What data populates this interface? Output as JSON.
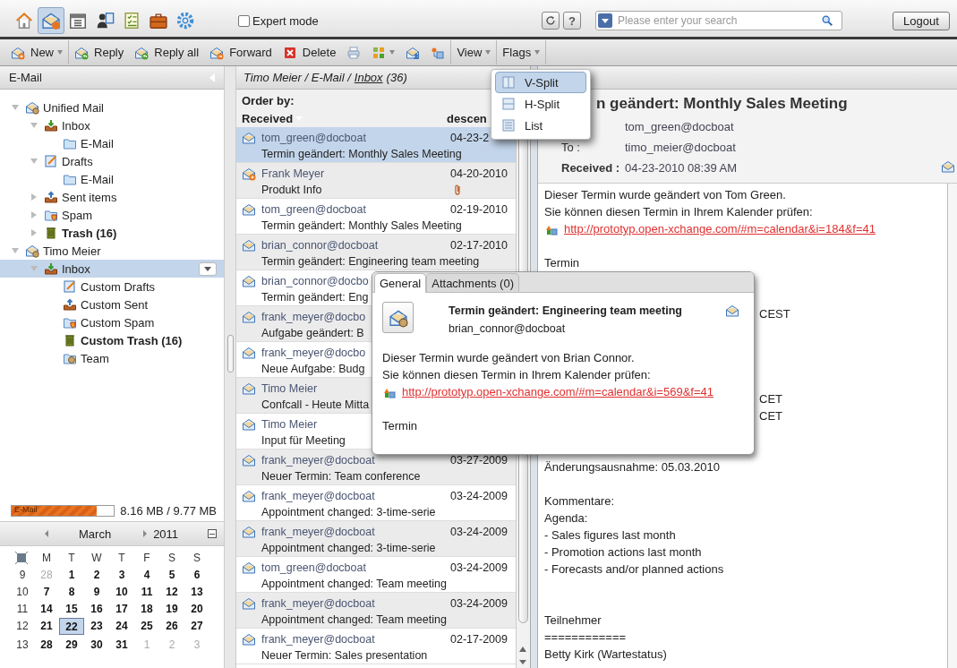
{
  "top_bar": {
    "apps": [
      {
        "kind": "home",
        "selected": false
      },
      {
        "kind": "mail",
        "selected": true
      },
      {
        "kind": "calendar",
        "selected": false
      },
      {
        "kind": "contacts",
        "selected": false
      },
      {
        "kind": "tasks",
        "selected": false
      },
      {
        "kind": "briefcase",
        "selected": false
      },
      {
        "kind": "settings",
        "selected": false
      }
    ],
    "expert_mode": {
      "label": "Expert mode",
      "checked": false
    },
    "help": "?",
    "search": {
      "placeholder": "Please enter your search"
    },
    "logout": "Logout"
  },
  "toolbar": [
    {
      "kind": "new",
      "label": "New",
      "caret": true
    },
    {
      "kind": "reply",
      "label": "Reply",
      "caret": false
    },
    {
      "kind": "reply_all",
      "label": "Reply all",
      "caret": false
    },
    {
      "kind": "forward",
      "label": "Forward",
      "caret": false
    },
    {
      "kind": "delete",
      "label": "Delete",
      "caret": false
    },
    {
      "kind": "print",
      "caret": false
    },
    {
      "kind": "layout",
      "caret": true
    },
    {
      "kind": "contacts_mail",
      "caret": false
    },
    {
      "kind": "share",
      "caret": false
    },
    {
      "kind": "menu",
      "label": "View",
      "caret": true
    },
    {
      "kind": "menu",
      "label": "Flags",
      "caret": true
    }
  ],
  "view_menu": [
    {
      "kind": "vsplit",
      "label": "V-Split",
      "selected": true
    },
    {
      "kind": "hsplit",
      "label": "H-Split",
      "selected": false
    },
    {
      "kind": "list",
      "label": "List",
      "selected": false
    }
  ],
  "sidebar": {
    "title": "E-Mail",
    "tree": [
      {
        "label": "Unified Mail",
        "kind": "account",
        "bold": false,
        "selected": false,
        "expanded": true,
        "children": [
          {
            "label": "Inbox",
            "kind": "inbox",
            "bold": false,
            "selected": false,
            "expanded": true,
            "children": [
              {
                "label": "E-Mail",
                "kind": "folder",
                "bold": false,
                "selected": false
              }
            ]
          },
          {
            "label": "Drafts",
            "kind": "drafts",
            "bold": false,
            "selected": false,
            "expanded": true,
            "children": [
              {
                "label": "E-Mail",
                "kind": "folder",
                "bold": false,
                "selected": false
              }
            ]
          },
          {
            "label": "Sent items",
            "kind": "sent",
            "bold": false,
            "selected": false,
            "expanded": false
          },
          {
            "label": "Spam",
            "kind": "spam",
            "bold": false,
            "selected": false,
            "expanded": false
          },
          {
            "label": "Trash (16)",
            "kind": "trash",
            "bold": true,
            "selected": false,
            "expanded": false
          }
        ]
      },
      {
        "label": "Timo Meier",
        "kind": "account",
        "bold": false,
        "selected": false,
        "expanded": true,
        "children": [
          {
            "label": "Inbox",
            "kind": "inbox",
            "bold": false,
            "selected": true,
            "expanded": true,
            "children": [
              {
                "label": "Custom Drafts",
                "kind": "drafts",
                "bold": false,
                "selected": false
              },
              {
                "label": "Custom Sent",
                "kind": "sent",
                "bold": false,
                "selected": false
              },
              {
                "label": "Custom Spam",
                "kind": "spam",
                "bold": false,
                "selected": false
              },
              {
                "label": "Custom Trash (16)",
                "kind": "trash",
                "bold": true,
                "selected": false
              },
              {
                "label": "Team",
                "kind": "shared",
                "bold": false,
                "selected": false
              }
            ]
          }
        ]
      }
    ],
    "quota": {
      "label": "E-Mail",
      "level": 0.835,
      "reading": "8.16 MB / 9.77 MB"
    },
    "calendar": {
      "month": "March",
      "year": "2011",
      "weekdays": [
        "M",
        "T",
        "W",
        "T",
        "F",
        "S",
        "S"
      ],
      "weeks": [
        {
          "week": "9",
          "days": [
            {
              "text": "28",
              "other": true,
              "selected": false
            },
            {
              "text": "1",
              "other": false,
              "selected": false
            },
            {
              "text": "2",
              "other": false,
              "selected": false
            },
            {
              "text": "3",
              "other": false,
              "selected": false
            },
            {
              "text": "4",
              "other": false,
              "selected": false
            },
            {
              "text": "5",
              "other": false,
              "selected": false
            },
            {
              "text": "6",
              "other": false,
              "selected": false
            }
          ]
        },
        {
          "week": "10",
          "days": [
            {
              "text": "7",
              "other": false,
              "selected": false
            },
            {
              "text": "8",
              "other": false,
              "selected": false
            },
            {
              "text": "9",
              "other": false,
              "selected": false
            },
            {
              "text": "10",
              "other": false,
              "selected": false
            },
            {
              "text": "11",
              "other": false,
              "selected": false
            },
            {
              "text": "12",
              "other": false,
              "selected": false
            },
            {
              "text": "13",
              "other": false,
              "selected": false
            }
          ]
        },
        {
          "week": "11",
          "days": [
            {
              "text": "14",
              "other": false,
              "selected": false
            },
            {
              "text": "15",
              "other": false,
              "selected": false
            },
            {
              "text": "16",
              "other": false,
              "selected": false
            },
            {
              "text": "17",
              "other": false,
              "selected": false
            },
            {
              "text": "18",
              "other": false,
              "selected": false
            },
            {
              "text": "19",
              "other": false,
              "selected": false
            },
            {
              "text": "20",
              "other": false,
              "selected": false
            }
          ]
        },
        {
          "week": "12",
          "days": [
            {
              "text": "21",
              "other": false,
              "selected": false
            },
            {
              "text": "22",
              "other": false,
              "selected": true
            },
            {
              "text": "23",
              "other": false,
              "selected": false
            },
            {
              "text": "24",
              "other": false,
              "selected": false
            },
            {
              "text": "25",
              "other": false,
              "selected": false
            },
            {
              "text": "26",
              "other": false,
              "selected": false
            },
            {
              "text": "27",
              "other": false,
              "selected": false
            }
          ]
        },
        {
          "week": "13",
          "days": [
            {
              "text": "28",
              "other": false,
              "selected": false
            },
            {
              "text": "29",
              "other": false,
              "selected": false
            },
            {
              "text": "30",
              "other": false,
              "selected": false
            },
            {
              "text": "31",
              "other": false,
              "selected": false
            },
            {
              "text": "1",
              "other": true,
              "selected": false
            },
            {
              "text": "2",
              "other": true,
              "selected": false
            },
            {
              "text": "3",
              "other": true,
              "selected": false
            }
          ]
        }
      ]
    }
  },
  "message_list": {
    "path": "Timo Meier / E-Mail /",
    "folder_link": "Inbox",
    "count": "(36)",
    "order_label": "Order by:",
    "sort_field": "Received",
    "sort_direction": "descen",
    "rows": [
      {
        "kind": "envelope",
        "sender": "tom_green@docboat",
        "date": "04-23-2",
        "subject": "Termin geändert: Monthly Sales Meeting",
        "attachment": false,
        "selected": true
      },
      {
        "kind": "replied",
        "sender": "Frank Meyer",
        "date": "04-20-2010",
        "subject": "Produkt Info",
        "attachment": true,
        "selected": false
      },
      {
        "kind": "envelope",
        "sender": "tom_green@docboat",
        "date": "02-19-2010",
        "subject": "Termin geändert: Monthly Sales Meeting",
        "attachment": false,
        "selected": false
      },
      {
        "kind": "envelope",
        "sender": "brian_connor@docboat",
        "date": "02-17-2010",
        "subject": "Termin geändert: Engineering team meeting",
        "attachment": false,
        "selected": false
      },
      {
        "kind": "envelope",
        "sender": "brian_connor@docbo",
        "subject": "Termin geändert: Eng",
        "attachment": false,
        "selected": false
      },
      {
        "kind": "envelope",
        "sender": "frank_meyer@docbo",
        "subject": "Aufgabe geändert: B",
        "attachment": false,
        "selected": false
      },
      {
        "kind": "envelope",
        "sender": "frank_meyer@docbo",
        "subject": "Neue Aufgabe: Budg",
        "attachment": false,
        "selected": false
      },
      {
        "kind": "envelope",
        "sender": "Timo Meier",
        "subject": "Confcall - Heute Mitta",
        "attachment": false,
        "selected": false
      },
      {
        "kind": "envelope",
        "sender": "Timo Meier",
        "subject": "Input für Meeting",
        "attachment": false,
        "selected": false
      },
      {
        "kind": "envelope",
        "sender": "frank_meyer@docboat",
        "date": "03-27-2009",
        "subject": "Neuer Termin: Team conference",
        "attachment": false,
        "selected": false
      },
      {
        "kind": "envelope",
        "sender": "frank_meyer@docboat",
        "date": "03-24-2009",
        "subject": "Appointment changed: 3-time-serie",
        "attachment": false,
        "selected": false
      },
      {
        "kind": "envelope",
        "sender": "frank_meyer@docboat",
        "date": "03-24-2009",
        "subject": "Appointment changed: 3-time-serie",
        "attachment": false,
        "selected": false
      },
      {
        "kind": "envelope",
        "sender": "tom_green@docboat",
        "date": "03-24-2009",
        "subject": "Appointment changed: Team meeting",
        "attachment": false,
        "selected": false
      },
      {
        "kind": "envelope",
        "sender": "frank_meyer@docboat",
        "date": "03-24-2009",
        "subject": "Appointment changed: Team meeting",
        "attachment": false,
        "selected": false
      },
      {
        "kind": "envelope",
        "sender": "frank_meyer@docboat",
        "date": "02-17-2009",
        "subject": "Neuer Termin: Sales presentation",
        "attachment": false,
        "selected": false
      }
    ]
  },
  "reader": {
    "subject": "n geändert: Monthly Sales Meeting",
    "from": "tom_green@docboat",
    "to_label": "To :",
    "to": "timo_meier@docboat",
    "received_label": "Received :",
    "received": "04-23-2010 08:39 AM",
    "body": [
      {
        "kind": "text",
        "text": "Dieser Termin wurde geändert von Tom Green."
      },
      {
        "kind": "text",
        "text": "Sie können diesen Termin in Ihrem Kalender prüfen:"
      },
      {
        "kind": "link",
        "text": "http://prototyp.open-xchange.com/#m=calendar&i=184&f=41"
      },
      {
        "kind": "gap"
      },
      {
        "kind": "text",
        "text": "Termin"
      },
      {
        "kind": "gap"
      },
      {
        "kind": "gap"
      },
      {
        "kind": "tail",
        "text": "CEST"
      },
      {
        "kind": "gap"
      },
      {
        "kind": "gap"
      },
      {
        "kind": "gap"
      },
      {
        "kind": "gap"
      },
      {
        "kind": "tail",
        "text": "CET"
      },
      {
        "kind": "tail",
        "text": "CET"
      },
      {
        "kind": "gap"
      },
      {
        "kind": "gap"
      },
      {
        "kind": "text",
        "text": "Änderungsausnahme: 05.03.2010"
      },
      {
        "kind": "gap"
      },
      {
        "kind": "text",
        "text": "Kommentare:"
      },
      {
        "kind": "text",
        "text": "Agenda:"
      },
      {
        "kind": "text",
        "text": "- Sales figures last month"
      },
      {
        "kind": "text",
        "text": "- Promotion actions last month"
      },
      {
        "kind": "text",
        "text": "- Forecasts and/or planned actions"
      },
      {
        "kind": "gap"
      },
      {
        "kind": "gap"
      },
      {
        "kind": "text",
        "text": "Teilnehmer"
      },
      {
        "kind": "text",
        "text": "============"
      },
      {
        "kind": "text",
        "text": "Betty Kirk (Wartestatus)"
      }
    ]
  },
  "preview_popup": {
    "tabs": [
      {
        "label": "General",
        "selected": true
      },
      {
        "label": "Attachments (0)",
        "selected": false
      }
    ],
    "subject": "Termin geändert: Engineering team meeting",
    "from": "brian_connor@docboat",
    "body": [
      {
        "kind": "text",
        "text": "Dieser Termin wurde geändert von Brian Connor."
      },
      {
        "kind": "text",
        "text": "Sie können diesen Termin in Ihrem Kalender prüfen:"
      },
      {
        "kind": "link",
        "text": "http://prototyp.open-xchange.com/#m=calendar&i=569&f=41"
      },
      {
        "kind": "gap"
      },
      {
        "kind": "text",
        "text": "Termin"
      }
    ]
  }
}
